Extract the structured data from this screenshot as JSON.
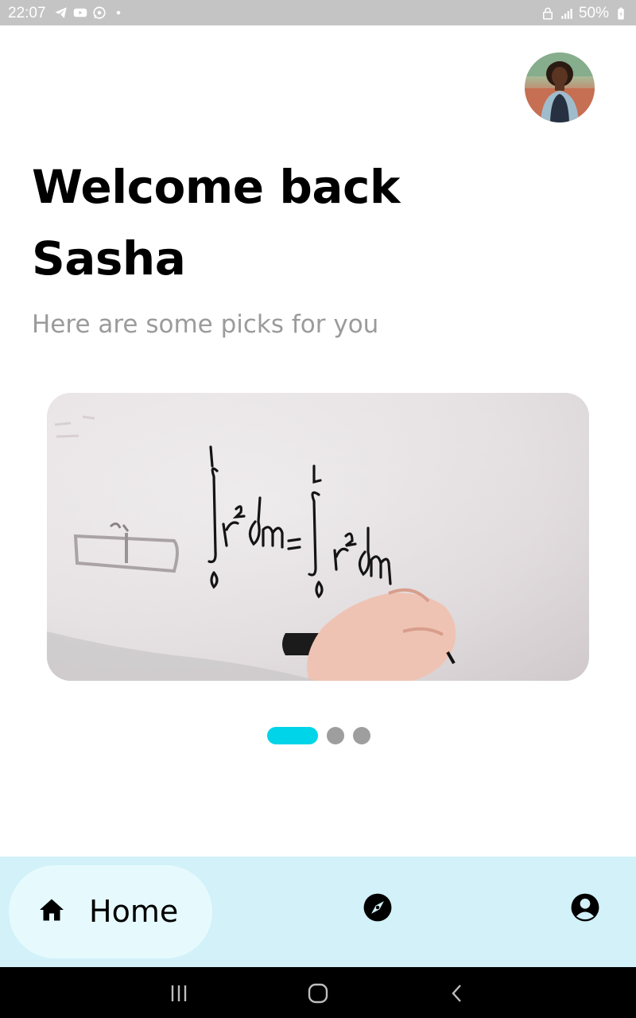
{
  "status_bar": {
    "time": "22:07",
    "left_icons": [
      "telegram-icon",
      "youtube-icon",
      "whatsapp-icon",
      "dot-icon"
    ],
    "battery": "50%",
    "right_icons": [
      "lock-icon",
      "signal-icon",
      "battery-icon"
    ]
  },
  "header": {
    "avatar": "avatar-photo"
  },
  "greeting": {
    "title": "Welcome back Sasha",
    "subtitle": "Here are some picks for you"
  },
  "carousel": {
    "pages": 3,
    "active_index": 0,
    "colors": {
      "active": "#00d4e8",
      "inactive": "#9e9e9e"
    }
  },
  "bottom_nav": {
    "background": "#d2f1f8",
    "items": [
      {
        "label": "Home",
        "icon": "home-icon",
        "selected": true
      },
      {
        "icon": "compass-icon",
        "selected": false
      },
      {
        "icon": "account-circle-icon",
        "selected": false
      }
    ]
  },
  "system_nav": {
    "buttons": [
      "recents-icon",
      "home-circle-icon",
      "back-icon"
    ]
  }
}
